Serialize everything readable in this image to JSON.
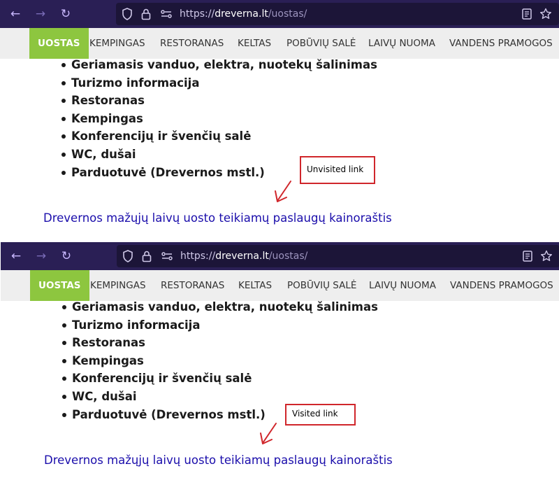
{
  "browser": {
    "url_scheme": "https://",
    "url_host": "dreverna.lt",
    "url_path": "/uostas/",
    "icon_color": "#c9b8ff",
    "toolbar_bg": "#2a1f55"
  },
  "menu": {
    "items": [
      "UOSTAS",
      "KEMPINGAS",
      "RESTORANAS",
      "KELTAS",
      "POBŪVIŲ SALĖ",
      "LAIVŲ NUOMA",
      "VANDENS PRAMOGOS"
    ],
    "active_index": 0,
    "active_color": "#8dc63f"
  },
  "services": [
    "Geriamasis vanduo, elektra, nuotekų šalinimas",
    "Turizmo informacija",
    "Restoranas",
    "Kempingas",
    "Konferencijų ir švenčių salė",
    "WC, dušai",
    "Parduotuvė (Drevernos mstl.)"
  ],
  "link_text": "Drevernos mažųjų laivų uosto teikiamų paslaugų kainoraštis",
  "link_color": "#1a0dab",
  "annotation_color": "#d0262b",
  "top": {
    "callout": "Unvisited link"
  },
  "bottom": {
    "callout": "Visited link"
  }
}
